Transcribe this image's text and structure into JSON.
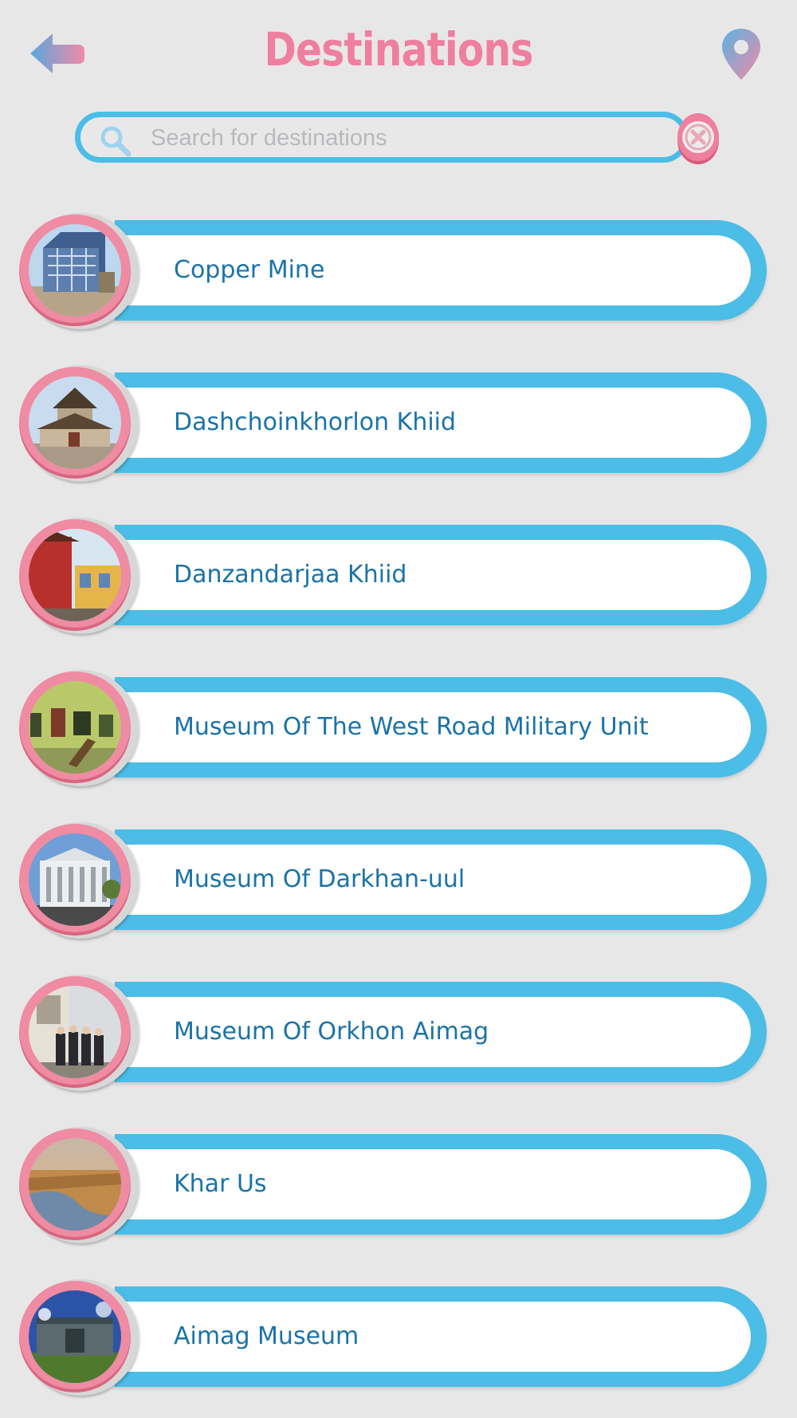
{
  "header": {
    "title": "Destinations",
    "back_icon": "back-arrow-icon",
    "location_icon": "map-pin-icon",
    "colors": {
      "pink": "#ef7f9f",
      "blue": "#4bbde6"
    }
  },
  "search": {
    "placeholder": "Search for destinations",
    "value": "",
    "icon": "search-icon",
    "clear_icon": "close-icon"
  },
  "destinations": [
    {
      "name": "Copper Mine"
    },
    {
      "name": "Dashchoinkhorlon Khiid"
    },
    {
      "name": "Danzandarjaa Khiid"
    },
    {
      "name": "Museum Of The West Road Military Unit"
    },
    {
      "name": "Museum Of Darkhan-uul"
    },
    {
      "name": "Museum Of Orkhon Aimag"
    },
    {
      "name": "Khar Us"
    },
    {
      "name": "Aimag Museum"
    }
  ],
  "theme": {
    "background": "#e8e7e8",
    "pill_blue": "#4bbde6",
    "label_color": "#1a73a8",
    "ring_pink": "#ef8ba3"
  }
}
